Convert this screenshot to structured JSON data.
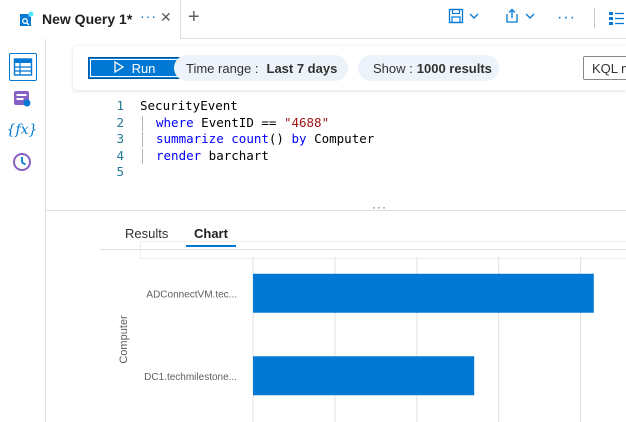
{
  "tab": {
    "title": "New Query 1*",
    "more": "···",
    "close": "✕",
    "add": "+"
  },
  "toolbar": {
    "run_label": "Run",
    "time_range_label": "Time range :",
    "time_range_value": "Last 7 days",
    "show_label": "Show :",
    "show_value": "1000 results",
    "language_label": "KQL mode"
  },
  "editor": {
    "lines": [
      {
        "num": "1",
        "tokens": [
          {
            "t": "SecurityEvent",
            "c": ""
          }
        ]
      },
      {
        "num": "2",
        "tokens": [
          {
            "t": "where",
            "c": "kw"
          },
          {
            "t": " EventID == ",
            "c": ""
          },
          {
            "t": "\"4688\"",
            "c": "str"
          }
        ]
      },
      {
        "num": "3",
        "tokens": [
          {
            "t": "summarize",
            "c": "kw"
          },
          {
            "t": " ",
            "c": ""
          },
          {
            "t": "count",
            "c": "kw"
          },
          {
            "t": "() ",
            "c": ""
          },
          {
            "t": "by",
            "c": "kw"
          },
          {
            "t": " Computer",
            "c": ""
          }
        ]
      },
      {
        "num": "4",
        "tokens": [
          {
            "t": "render",
            "c": "kw"
          },
          {
            "t": " barchart",
            "c": ""
          }
        ]
      },
      {
        "num": "5",
        "tokens": []
      }
    ]
  },
  "splitter_dots": "···",
  "results_tabs": [
    {
      "label": "Results",
      "active": false
    },
    {
      "label": "Chart",
      "active": true
    }
  ],
  "chart_data": {
    "type": "bar",
    "orientation": "horizontal",
    "categories": [
      "ADConnectVM.tec...",
      "DC1.techmilestone..."
    ],
    "values": [
      1040,
      675
    ],
    "xlim": [
      0,
      1120
    ],
    "ticks": [
      0,
      250,
      500,
      750,
      1000
    ],
    "ylabel": "Computer",
    "xlabel": "",
    "grid": true,
    "color": "#0078d4"
  },
  "colors": {
    "accent": "#0078d4",
    "pill_bg": "#edf3fa",
    "border": "#e1dfdd"
  }
}
